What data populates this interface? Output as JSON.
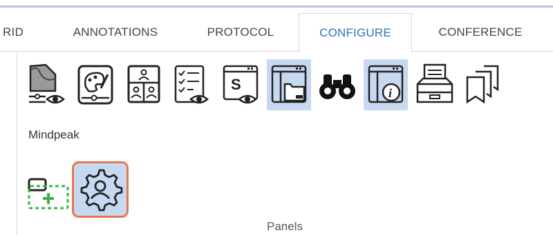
{
  "tabs": [
    {
      "id": "grid",
      "label": "RID"
    },
    {
      "id": "annotations",
      "label": "ANNOTATIONS"
    },
    {
      "id": "protocol",
      "label": "PROTOCOL"
    },
    {
      "id": "configure",
      "label": "CONFIGURE",
      "active": true
    },
    {
      "id": "conference",
      "label": "CONFERENCE"
    }
  ],
  "toolbar": {
    "tools": [
      {
        "icon": "image-view-settings-icon"
      },
      {
        "icon": "palette-settings-icon"
      },
      {
        "icon": "user-grid-icon"
      },
      {
        "icon": "checklist-view-icon"
      },
      {
        "icon": "script-view-icon"
      },
      {
        "icon": "folder-window-icon",
        "selected": true
      },
      {
        "icon": "binoculars-icon"
      },
      {
        "icon": "info-window-icon",
        "selected": true
      },
      {
        "icon": "inbox-tray-icon"
      },
      {
        "icon": "stacked-pages-icon"
      }
    ]
  },
  "group_label": "Mindpeak",
  "panels": {
    "caption": "Panels",
    "buttons": [
      {
        "icon": "add-panel-icon"
      },
      {
        "icon": "user-settings-gear-icon",
        "highlighted": true,
        "highlight_color": "#e8764a"
      }
    ]
  },
  "colors": {
    "active_tab_text": "#2f73b6",
    "selected_tool_bg": "#c7d9f1",
    "highlight_border": "#e8764a",
    "add_panel_dashed": "#3cb04a"
  }
}
